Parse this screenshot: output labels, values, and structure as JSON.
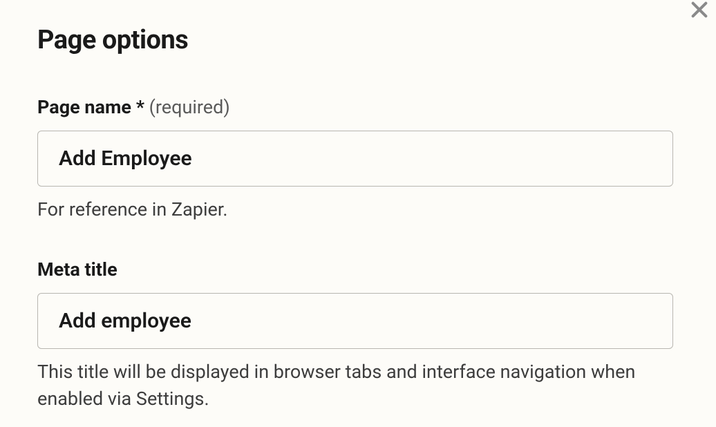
{
  "dialog": {
    "title": "Page options"
  },
  "fields": {
    "page_name": {
      "label": "Page name",
      "required_mark": "*",
      "required_text": "(required)",
      "value": "Add Employee",
      "help": "For reference in Zapier."
    },
    "meta_title": {
      "label": "Meta title",
      "value": "Add employee",
      "help": "This title will be displayed in browser tabs and interface navigation when enabled via Settings."
    }
  }
}
